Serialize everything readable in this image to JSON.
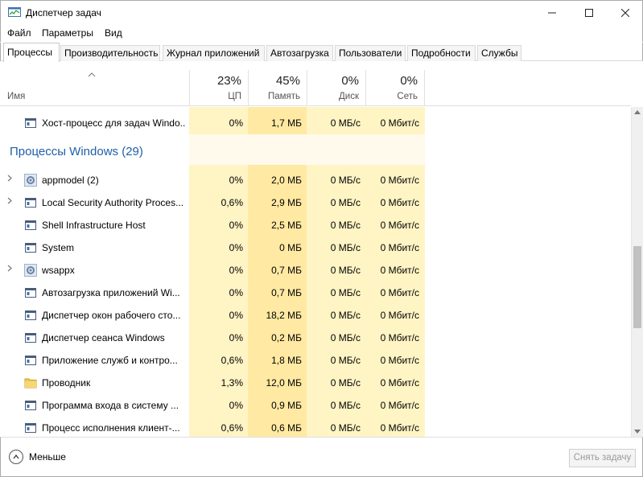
{
  "window": {
    "title": "Диспетчер задач",
    "minimize_icon": "minimize-icon",
    "maximize_icon": "maximize-icon",
    "close_icon": "close-icon"
  },
  "menu": [
    "Файл",
    "Параметры",
    "Вид"
  ],
  "tabs": [
    "Процессы",
    "Производительность",
    "Журнал приложений",
    "Автозагрузка",
    "Пользователи",
    "Подробности",
    "Службы"
  ],
  "active_tab": "Процессы",
  "columns": {
    "name": "Имя",
    "cpu": {
      "pct": "23%",
      "label": "ЦП"
    },
    "memory": {
      "pct": "45%",
      "label": "Память"
    },
    "disk": {
      "pct": "0%",
      "label": "Диск"
    },
    "network": {
      "pct": "0%",
      "label": "Сеть"
    }
  },
  "top_row": {
    "name": "Хост-процесс для задач Windo...",
    "cpu": "0%",
    "memory": "1,7 МБ",
    "disk": "0 МБ/с",
    "network": "0 Мбит/с",
    "icon": "window-process-icon"
  },
  "group": {
    "title": "Процессы Windows (29)"
  },
  "processes": [
    {
      "name": "appmodel (2)",
      "cpu": "0%",
      "memory": "2,0 МБ",
      "disk": "0 МБ/с",
      "network": "0 Мбит/с",
      "expandable": true,
      "icon": "gear-icon"
    },
    {
      "name": "Local Security Authority Proces...",
      "cpu": "0,6%",
      "memory": "2,9 МБ",
      "disk": "0 МБ/с",
      "network": "0 Мбит/с",
      "expandable": true,
      "icon": "window-process-icon"
    },
    {
      "name": "Shell Infrastructure Host",
      "cpu": "0%",
      "memory": "2,5 МБ",
      "disk": "0 МБ/с",
      "network": "0 Мбит/с",
      "expandable": false,
      "icon": "window-process-icon"
    },
    {
      "name": "System",
      "cpu": "0%",
      "memory": "0 МБ",
      "disk": "0 МБ/с",
      "network": "0 Мбит/с",
      "expandable": false,
      "icon": "window-process-icon"
    },
    {
      "name": "wsappx",
      "cpu": "0%",
      "memory": "0,7 МБ",
      "disk": "0 МБ/с",
      "network": "0 Мбит/с",
      "expandable": true,
      "icon": "gear-icon"
    },
    {
      "name": "Автозагрузка приложений Wi...",
      "cpu": "0%",
      "memory": "0,7 МБ",
      "disk": "0 МБ/с",
      "network": "0 Мбит/с",
      "expandable": false,
      "icon": "window-process-icon"
    },
    {
      "name": "Диспетчер окон рабочего сто...",
      "cpu": "0%",
      "memory": "18,2 МБ",
      "disk": "0 МБ/с",
      "network": "0 Мбит/с",
      "expandable": false,
      "icon": "window-process-icon"
    },
    {
      "name": "Диспетчер сеанса  Windows",
      "cpu": "0%",
      "memory": "0,2 МБ",
      "disk": "0 МБ/с",
      "network": "0 Мбит/с",
      "expandable": false,
      "icon": "window-process-icon"
    },
    {
      "name": "Приложение служб и контро...",
      "cpu": "0,6%",
      "memory": "1,8 МБ",
      "disk": "0 МБ/с",
      "network": "0 Мбит/с",
      "expandable": false,
      "icon": "window-process-icon"
    },
    {
      "name": "Проводник",
      "cpu": "1,3%",
      "memory": "12,0 МБ",
      "disk": "0 МБ/с",
      "network": "0 Мбит/с",
      "expandable": false,
      "icon": "folder-icon"
    },
    {
      "name": "Программа входа в систему ...",
      "cpu": "0%",
      "memory": "0,9 МБ",
      "disk": "0 МБ/с",
      "network": "0 Мбит/с",
      "expandable": false,
      "icon": "window-process-icon"
    },
    {
      "name": "Процесс исполнения клиент-...",
      "cpu": "0,6%",
      "memory": "0,6 МБ",
      "disk": "0 МБ/с",
      "network": "0 Мбит/с",
      "expandable": false,
      "icon": "window-process-icon"
    }
  ],
  "footer": {
    "less_label": "Меньше",
    "end_task_label": "Снять задачу"
  },
  "colors": {
    "cpu_bg_light": "#fff4c4",
    "cpu_bg_mid": "#ffe9a3",
    "mem_bg": "#ffe9a3",
    "disk_bg": "#fff4c4",
    "net_bg": "#fff4c4",
    "group_title": "#1f5fa8"
  }
}
